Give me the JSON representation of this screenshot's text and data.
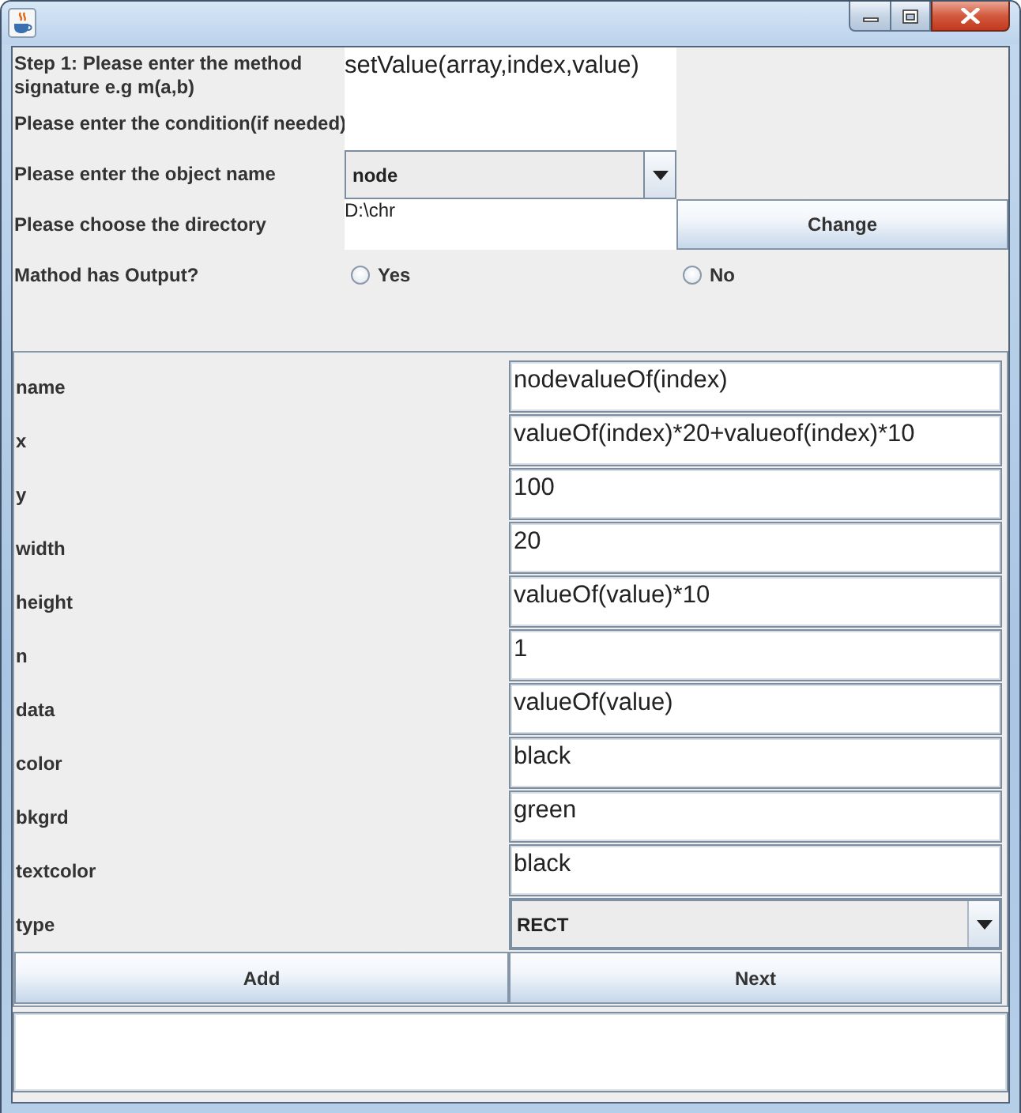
{
  "method_form": {
    "signature": {
      "label": "Step 1: Please enter the method signature e.g m(a,b)",
      "value": "setValue(array,index,value)"
    },
    "condition": {
      "label": "Please enter the condition(if needed)"
    },
    "object_name": {
      "label": "Please enter the object name",
      "value": "node"
    },
    "directory": {
      "label": "Please choose the directory",
      "value": "D:\\chr",
      "button": "Change"
    },
    "has_output": {
      "label": "Mathod has Output?",
      "options": [
        {
          "label": "Yes",
          "selected": false
        },
        {
          "label": "No",
          "selected": false
        }
      ]
    }
  },
  "properties": [
    {
      "name": "name",
      "kind": "text",
      "value": "nodevalueOf(index)"
    },
    {
      "name": "x",
      "kind": "text",
      "value": "valueOf(index)*20+valueof(index)*10"
    },
    {
      "name": "y",
      "kind": "text",
      "value": "100"
    },
    {
      "name": "width",
      "kind": "text",
      "value": "20"
    },
    {
      "name": "height",
      "kind": "text",
      "value": "valueOf(value)*10"
    },
    {
      "name": "n",
      "kind": "text",
      "value": "1"
    },
    {
      "name": "data",
      "kind": "text",
      "value": "valueOf(value)"
    },
    {
      "name": "color",
      "kind": "text",
      "value": "black"
    },
    {
      "name": "bkgrd",
      "kind": "text",
      "value": "green"
    },
    {
      "name": "textcolor",
      "kind": "text",
      "value": "black"
    },
    {
      "name": "type",
      "kind": "dropdown",
      "value": "RECT"
    }
  ],
  "buttons": [
    "Add",
    "Next"
  ]
}
